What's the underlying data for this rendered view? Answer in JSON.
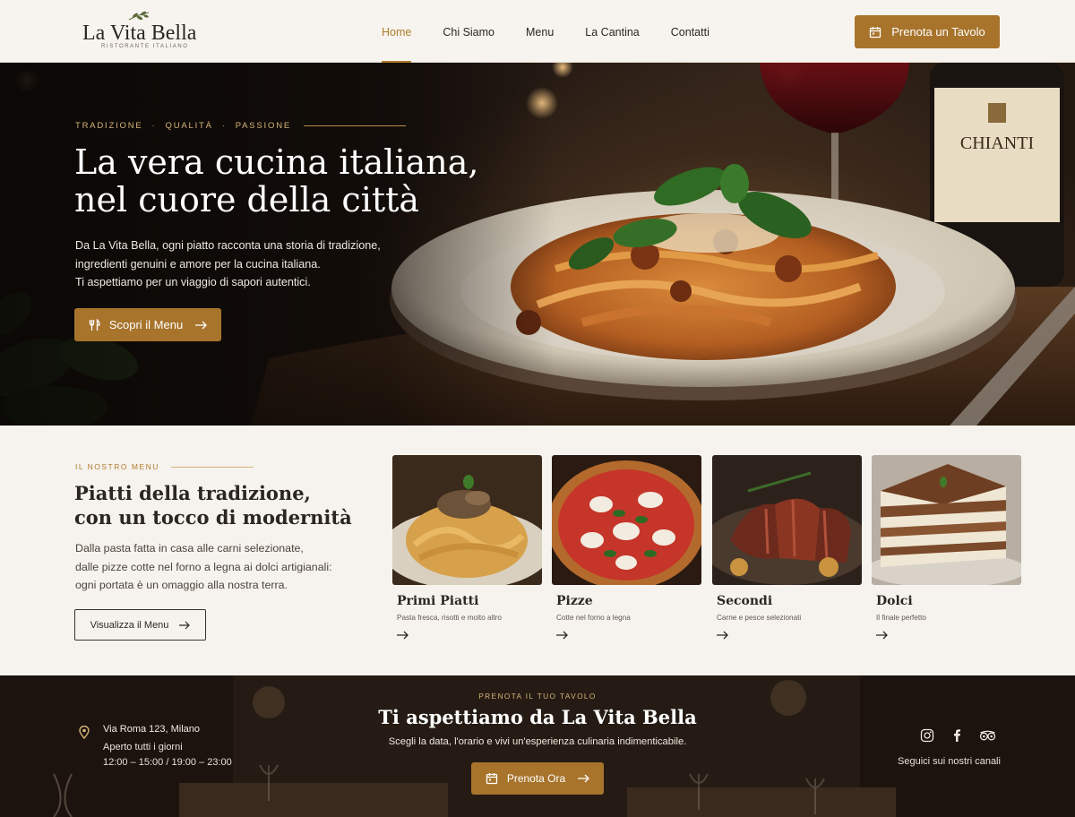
{
  "brand": {
    "name": "La Vita Bella",
    "tagline": "RISTORANTE ITALIANO"
  },
  "nav": {
    "items": [
      {
        "label": "Home",
        "active": true
      },
      {
        "label": "Chi Siamo",
        "active": false
      },
      {
        "label": "Menu",
        "active": false
      },
      {
        "label": "La Cantina",
        "active": false
      },
      {
        "label": "Contatti",
        "active": false
      }
    ],
    "cta_label": "Prenota un Tavolo"
  },
  "hero": {
    "eyebrow": [
      "TRADIZIONE",
      "QUALITÀ",
      "PASSIONE"
    ],
    "eyebrow_sep": "·",
    "title_line1": "La vera cucina italiana,",
    "title_line2": "nel cuore della città",
    "text_lines": [
      "Da La Vita Bella, ogni piatto racconta una storia di tradizione,",
      "ingredienti genuini e amore per la cucina italiana.",
      "Ti aspettiamo per un viaggio di sapori autentici."
    ],
    "button_label": "Scopri il Menu",
    "bottle_label": "CHIANTI"
  },
  "menu": {
    "eyebrow": "IL NOSTRO MENU",
    "title_line1": "Piatti della tradizione,",
    "title_line2": "con un tocco di modernità",
    "text_lines": [
      "Dalla pasta fatta in casa alle carni selezionate,",
      "dalle pizze cotte nel forno a legna ai dolci artigianali:",
      "ogni portata è un omaggio alla nostra terra."
    ],
    "button_label": "Visualizza il Menu",
    "cards": [
      {
        "title": "Primi Piatti",
        "subtitle": "Pasta fresca, risotti e molto altro"
      },
      {
        "title": "Pizze",
        "subtitle": "Cotte nel forno a legna"
      },
      {
        "title": "Secondi",
        "subtitle": "Carne e pesce selezionati"
      },
      {
        "title": "Dolci",
        "subtitle": "Il finale perfetto"
      }
    ]
  },
  "footer": {
    "address": "Via Roma 123, Milano",
    "hours_label": "Aperto tutti i giorni",
    "hours": "12:00 – 15:00 / 19:00 – 23:00",
    "eyebrow": "PRENOTA IL TUO TAVOLO",
    "title": "Ti aspettiamo da La Vita Bella",
    "text": "Scegli la data, l'orario e vivi un'esperienza culinaria indimenticabile.",
    "button_label": "Prenota Ora",
    "social_icons": [
      "instagram-icon",
      "facebook-icon",
      "tripadvisor-icon"
    ],
    "follow_label": "Seguici sui nostri canali"
  },
  "colors": {
    "accent": "#a8742c",
    "background": "#f6f3ee",
    "dark": "#2b2621"
  }
}
